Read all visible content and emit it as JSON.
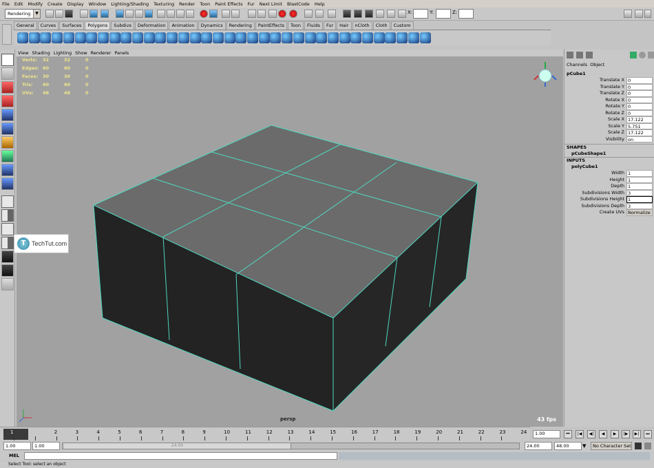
{
  "menubar": [
    "File",
    "Edit",
    "Modify",
    "Create",
    "Display",
    "Window",
    "Lighting/Shading",
    "Texturing",
    "Render",
    "Toon",
    "Paint Effects",
    "Fur",
    "Next Limit",
    "BlastCode",
    "Help"
  ],
  "status_line": {
    "mode": "Rendering",
    "x_label": "X:",
    "y_label": "Y:",
    "z_label": "Z:"
  },
  "shelf_tabs": [
    "General",
    "Curves",
    "Surfaces",
    "Polygons",
    "Subdivs",
    "Deformation",
    "Animation",
    "Dynamics",
    "Rendering",
    "PaintEffects",
    "Toon",
    "Fluids",
    "Fur",
    "Hair",
    "nCloth",
    "Cloth",
    "Custom"
  ],
  "active_shelf_tab": "Polygons",
  "panel_menu": [
    "View",
    "Shading",
    "Lighting",
    "Show",
    "Renderer",
    "Panels"
  ],
  "hud": [
    {
      "label": "Verts:",
      "a": "32",
      "b": "32",
      "c": "0"
    },
    {
      "label": "Edges:",
      "a": "60",
      "b": "60",
      "c": "0"
    },
    {
      "label": "Faces:",
      "a": "30",
      "b": "30",
      "c": "0"
    },
    {
      "label": "Tris:",
      "a": "60",
      "b": "60",
      "c": "0"
    },
    {
      "label": "UVs:",
      "a": "48",
      "b": "48",
      "c": "0"
    }
  ],
  "camera": "persp",
  "fps": "43 fps",
  "channel_box": {
    "menu": [
      "Channels",
      "Object"
    ],
    "object": "pCube1",
    "attrs": [
      {
        "name": "Translate X",
        "value": "0"
      },
      {
        "name": "Translate Y",
        "value": "0"
      },
      {
        "name": "Translate Z",
        "value": "0"
      },
      {
        "name": "Rotate X",
        "value": "0"
      },
      {
        "name": "Rotate Y",
        "value": "0"
      },
      {
        "name": "Rotate Z",
        "value": "0"
      },
      {
        "name": "Scale X",
        "value": "17.122"
      },
      {
        "name": "Scale Y",
        "value": "5.751"
      },
      {
        "name": "Scale Z",
        "value": "17.122"
      },
      {
        "name": "Visibility",
        "value": "on"
      }
    ],
    "shapes_header": "SHAPES",
    "shape_name": "pCubeShape1",
    "inputs_header": "INPUTS",
    "input_name": "polyCube1",
    "input_attrs": [
      {
        "name": "Width",
        "value": "1"
      },
      {
        "name": "Height",
        "value": "1"
      },
      {
        "name": "Depth",
        "value": "1"
      },
      {
        "name": "Subdivisions Width",
        "value": "3"
      },
      {
        "name": "Subdivisions Height",
        "value": "1"
      },
      {
        "name": "Subdivisions Depth",
        "value": "3"
      },
      {
        "name": "Create UVs",
        "value": "Normalize C"
      }
    ]
  },
  "watermark": {
    "letter": "T",
    "text": "TechTut.com"
  },
  "timeline": {
    "start_frame": "1",
    "ticks": [
      "2",
      "3",
      "4",
      "5",
      "6",
      "7",
      "8",
      "9",
      "10",
      "11",
      "12",
      "13",
      "14",
      "15",
      "16",
      "17",
      "18",
      "19",
      "20",
      "21",
      "22",
      "23",
      "24"
    ],
    "current_frame": "1.00"
  },
  "range": {
    "start": "1.00",
    "anim_start": "1.00",
    "slider_label": "24.00",
    "end": "24.00",
    "anim_end": "48.00",
    "character_set": "No Character Set"
  },
  "command_line": {
    "label": "MEL"
  },
  "help_line": "Select Tool: select an object"
}
